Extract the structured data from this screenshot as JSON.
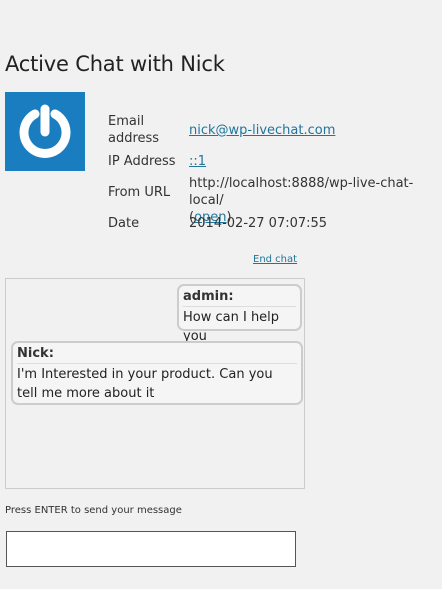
{
  "page": {
    "title": "Active Chat with Nick"
  },
  "visitor": {
    "avatar_icon": "power-icon",
    "email_label_line1": "Email",
    "email_label_line2": "address",
    "email": "nick@wp-livechat.com",
    "ip_label": "IP Address",
    "ip": "::1",
    "url_label": "From URL",
    "url": "http://localhost:8888/wp-live-chat-local/",
    "url_open_prefix": "(",
    "url_open_label": "open",
    "url_open_suffix": ")",
    "date_label": "Date",
    "date": "2014-02-27 07:07:55"
  },
  "actions": {
    "end_chat_label": "End chat"
  },
  "messages": [
    {
      "sender": "admin:",
      "text": "How can I help you"
    },
    {
      "sender": "Nick:",
      "text": "I'm Interested in your product. Can you tell me more about it"
    }
  ],
  "composer": {
    "hint": "Press ENTER to send your message",
    "value": "",
    "placeholder": ""
  },
  "colors": {
    "avatar_bg": "#1a7dc0",
    "link": "#21759b",
    "background": "#f1f1f1"
  }
}
